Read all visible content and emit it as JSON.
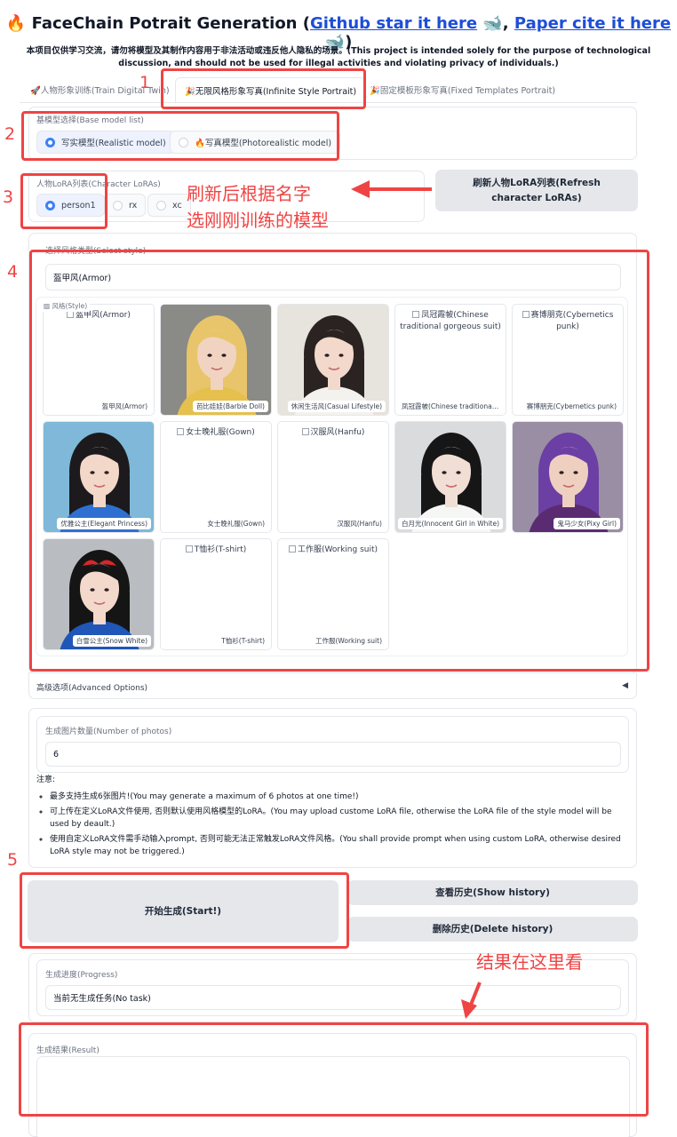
{
  "header": {
    "title_prefix": "🔥 FaceChain Potrait Generation (",
    "github_link": "Github star it here",
    "whale1": " 🐋, ",
    "paper_link": "Paper cite it here",
    "title_suffix": " 🐋)",
    "disclaimer": "本项目仅供学习交流，请勿将模型及其制作内容用于非法活动或违反他人隐私的场景。(This project is intended solely for the purpose of technological discussion, and should not be used for illegal activities and violating privacy of individuals.)"
  },
  "tabs": [
    {
      "label": "🚀人物形象训练(Train Digital Twin)"
    },
    {
      "label": "🎉无限风格形象写真(Infinite Style Portrait)"
    },
    {
      "label": "🎉固定模板形象写真(Fixed Templates Portrait)"
    }
  ],
  "base_model": {
    "label": "基模型选择(Base model list)",
    "options": [
      "写实模型(Realistic model)",
      "🔥写真模型(Photorealistic model)"
    ],
    "selected": "写实模型(Realistic model)"
  },
  "character": {
    "label": "人物LoRA列表(Character LoRAs)",
    "options": [
      "person1",
      "rx",
      "xc"
    ],
    "selected": "person1",
    "refresh_button": "刷新人物LoRA列表(Refresh character LoRAs)"
  },
  "style": {
    "select_label": "选择风格类型(Select style)",
    "value": "盔甲风(Armor)",
    "gallery_label": "风格(Style)",
    "items": [
      {
        "caption": "盔甲风(Armor)",
        "alt": "盔甲风(Armor)",
        "image": "broken"
      },
      {
        "caption": "芭比娃娃(Barbie Doll)",
        "image": "barbie"
      },
      {
        "caption": "休闲生活风(Casual Lifestyle)",
        "image": "casual"
      },
      {
        "caption": "凤冠霞帔(Chinese traditional gorgeous suit)",
        "alt": "凤冠霞帔(Chinese traditional gorgeous suit)",
        "image": "broken"
      },
      {
        "caption": "赛博朋克(Cybernetics punk)",
        "alt": "赛博朋克(Cybernetics punk)",
        "image": "broken"
      },
      {
        "caption": "优雅公主(Elegant Princess)",
        "image": "princess"
      },
      {
        "caption": "女士晚礼服(Gown)",
        "alt": "女士晚礼服(Gown)",
        "image": "broken"
      },
      {
        "caption": "汉服风(Hanfu)",
        "alt": "汉服风(Hanfu)",
        "image": "broken"
      },
      {
        "caption": "白月光(Innocent Girl in White)",
        "image": "innocent"
      },
      {
        "caption": "鬼马少女(Pixy Girl)",
        "image": "pixy"
      },
      {
        "caption": "白雪公主(Snow White)",
        "image": "snow"
      },
      {
        "caption": "T恤衫(T-shirt)",
        "alt": "T恤衫(T-shirt)",
        "image": "broken"
      },
      {
        "caption": "工作服(Working suit)",
        "alt": "工作服(Working suit)",
        "image": "broken"
      }
    ]
  },
  "advanced": {
    "label": "高级选项(Advanced Options)",
    "arrow": "◀"
  },
  "num_photos": {
    "label": "生成图片数量(Number of photos)",
    "value": "6"
  },
  "notes": {
    "title": "注意:",
    "items": [
      "最多支持生成6张图片!(You may generate a maximum of 6 photos at one time!)",
      "可上传在定义LoRA文件使用, 否则默认使用风格模型的LoRA。(You may upload custome LoRA file, otherwise the LoRA file of the style model will be used by deault.)",
      "使用自定义LoRA文件需手动输入prompt, 否则可能无法正常触发LoRA文件风格。(You shall provide prompt when using custom LoRA, otherwise desired LoRA style may not be triggered.)"
    ]
  },
  "actions": {
    "start": "开始生成(Start!)",
    "show_history": "查看历史(Show history)",
    "delete_history": "删除历史(Delete history)"
  },
  "progress": {
    "label": "生成进度(Progress)",
    "value": "当前无生成任务(No task)"
  },
  "result": {
    "label": "生成结果(Result)"
  },
  "annotations": {
    "n1": "1",
    "n2": "2",
    "n3": "3",
    "n4": "4",
    "n5": "5",
    "refresh_note_line1": "刷新后根据名字",
    "refresh_note_line2": "选刚刚训练的模型",
    "result_note": "结果在这里看",
    "color": "#ef4444"
  }
}
